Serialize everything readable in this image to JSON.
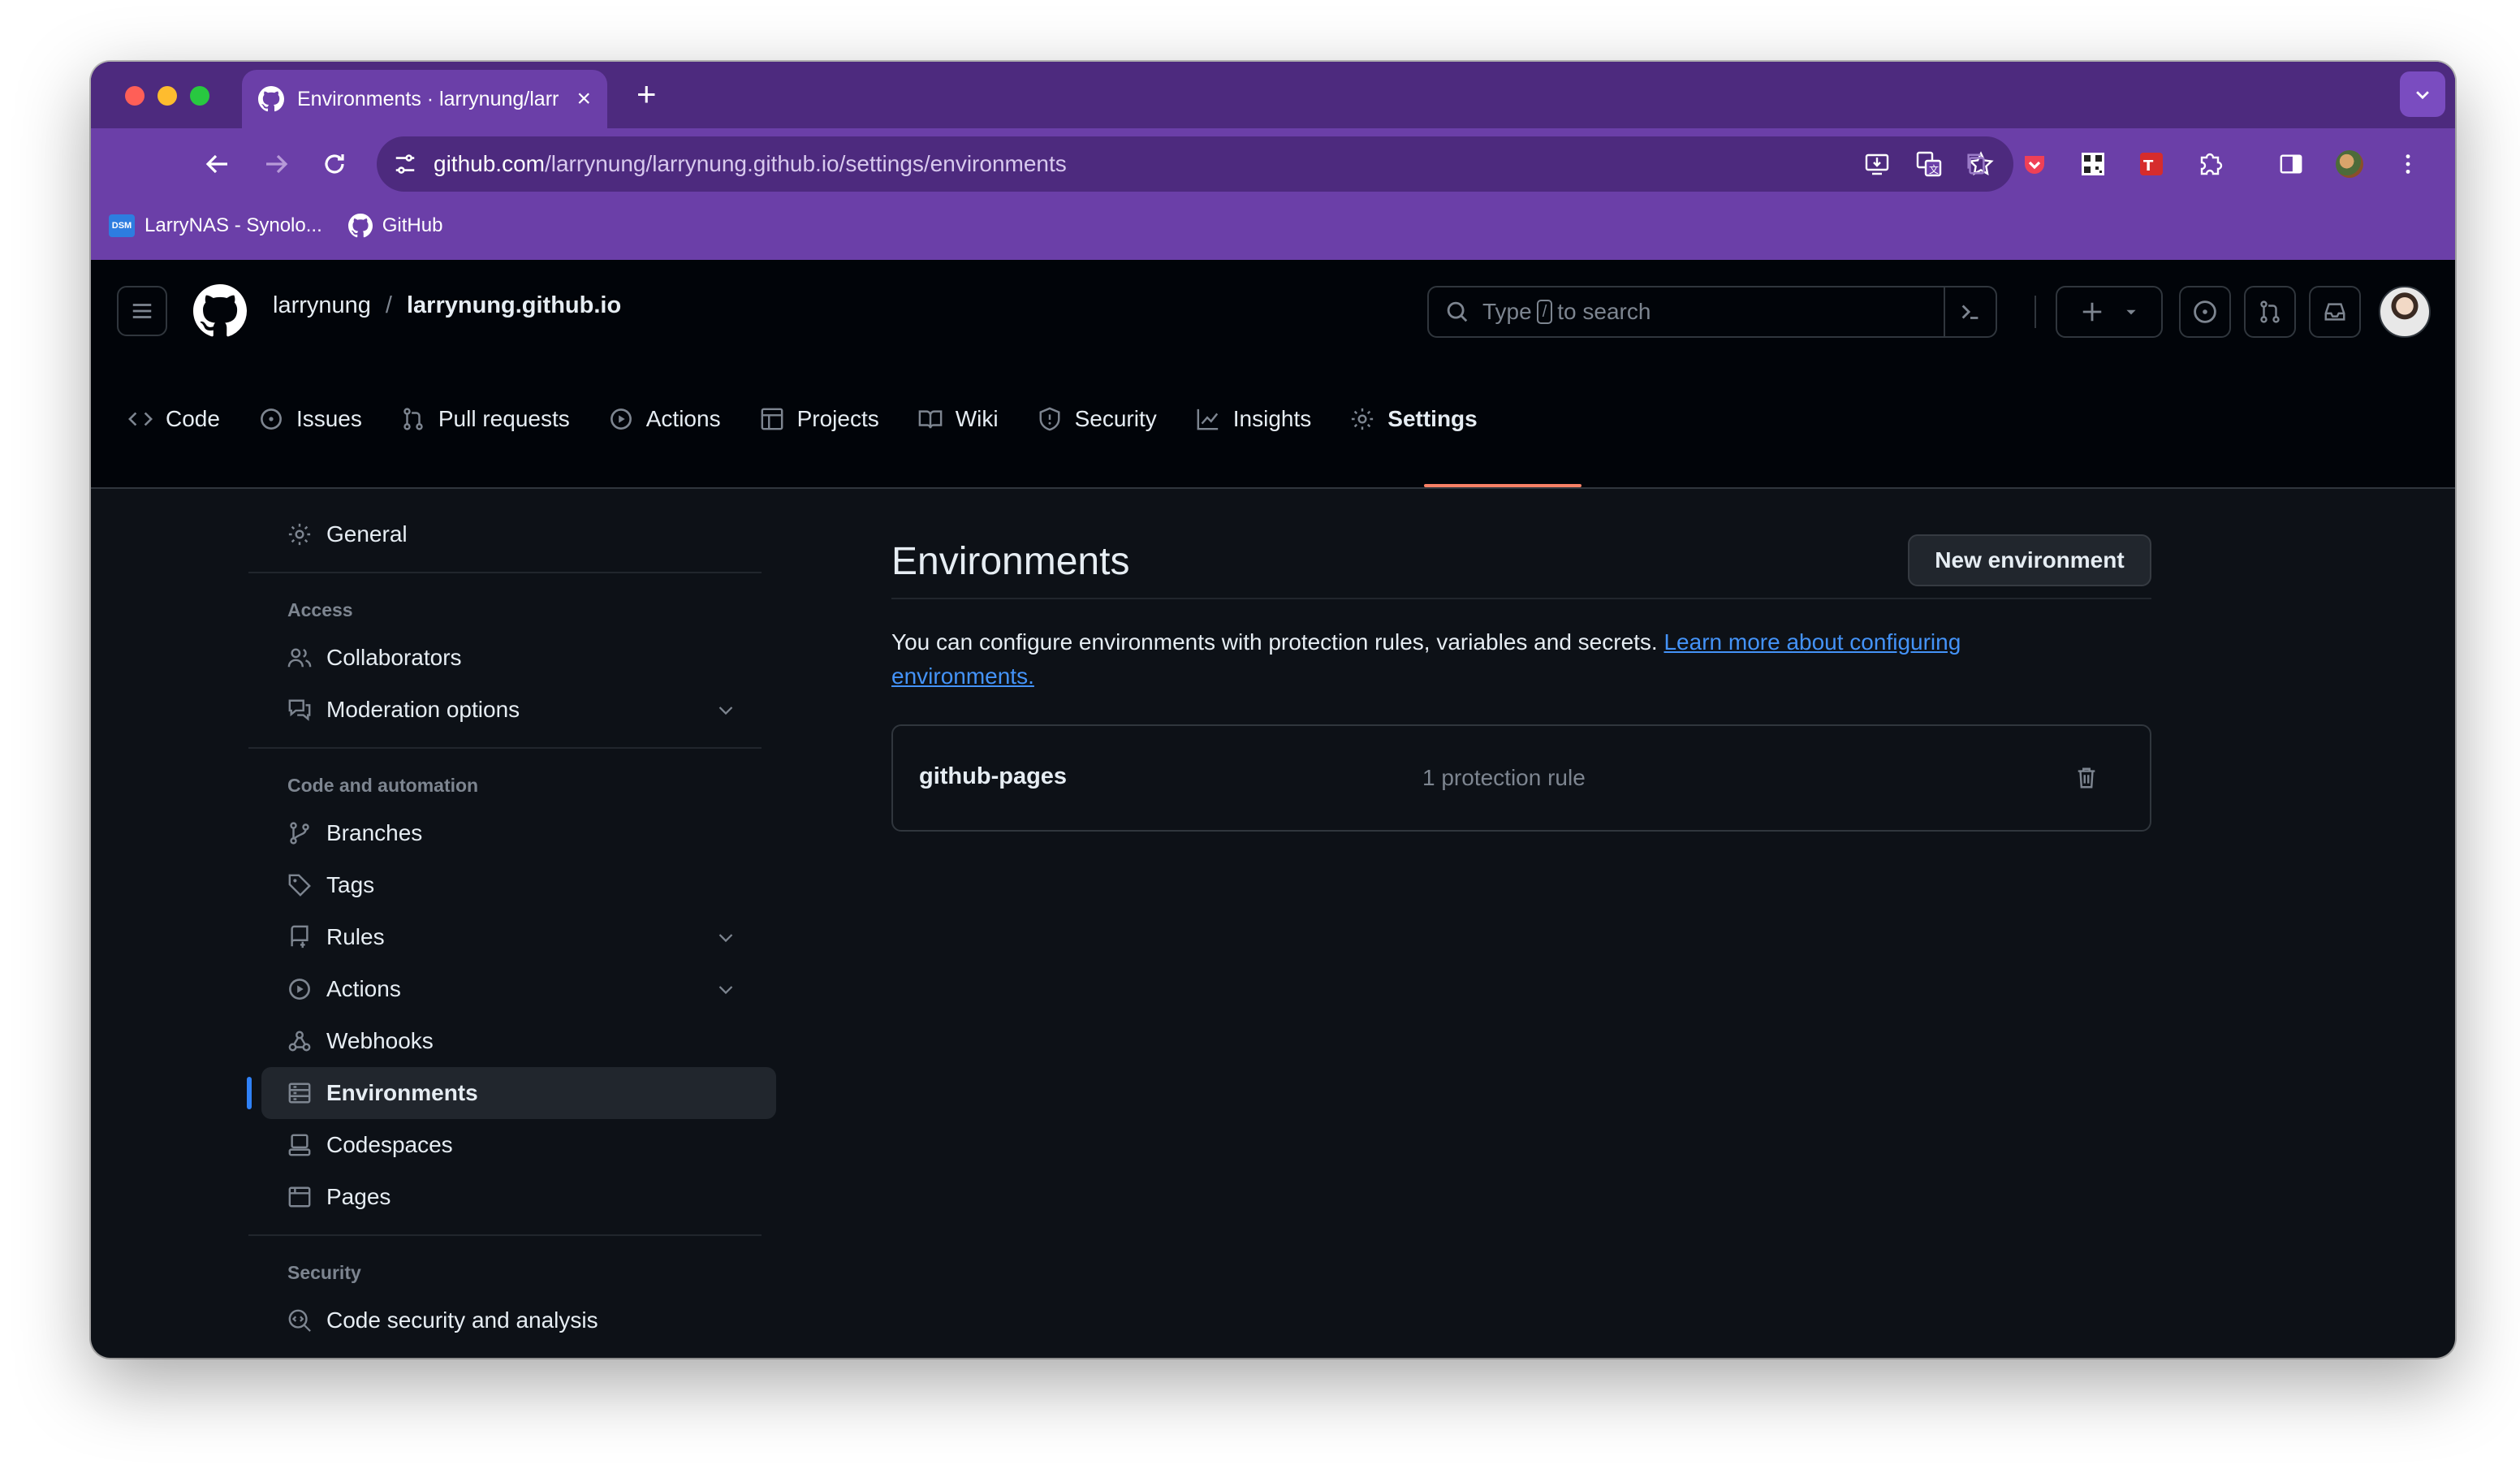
{
  "browser": {
    "tab_title": "Environments · larrynung/larr",
    "url_host": "github.com",
    "url_path": "/larrynung/larrynung.github.io/settings/environments",
    "bookmarks": [
      {
        "label": "LarryNAS - Synolo...",
        "icon": "dsm-icon",
        "badge": "DSM"
      },
      {
        "label": "GitHub",
        "icon": "github-icon"
      }
    ]
  },
  "header": {
    "owner": "larrynung",
    "separator": "/",
    "repo": "larrynung.github.io",
    "search_prefix": "Type",
    "search_key": "/",
    "search_suffix": "to search"
  },
  "repo_nav": [
    {
      "label": "Code",
      "icon": "code-icon"
    },
    {
      "label": "Issues",
      "icon": "issue-icon"
    },
    {
      "label": "Pull requests",
      "icon": "pull-request-icon"
    },
    {
      "label": "Actions",
      "icon": "play-icon"
    },
    {
      "label": "Projects",
      "icon": "table-icon"
    },
    {
      "label": "Wiki",
      "icon": "book-icon"
    },
    {
      "label": "Security",
      "icon": "shield-icon"
    },
    {
      "label": "Insights",
      "icon": "graph-icon"
    },
    {
      "label": "Settings",
      "icon": "gear-icon",
      "active": true
    }
  ],
  "sidebar": {
    "general": "General",
    "access_heading": "Access",
    "collaborators": "Collaborators",
    "moderation": "Moderation options",
    "code_heading": "Code and automation",
    "branches": "Branches",
    "tags": "Tags",
    "rules": "Rules",
    "actions": "Actions",
    "webhooks": "Webhooks",
    "environments": "Environments",
    "codespaces": "Codespaces",
    "pages": "Pages",
    "security_heading": "Security",
    "code_security": "Code security and analysis"
  },
  "main": {
    "title": "Environments",
    "new_button": "New environment",
    "description": "You can configure environments with protection rules, variables and secrets.",
    "learn_more": "Learn more about configuring environments.",
    "environments": [
      {
        "name": "github-pages",
        "rules": "1 protection rule"
      }
    ]
  },
  "colors": {
    "browser_frame": "#6b3fa8",
    "page_bg": "#0d1117",
    "header_bg": "#010409",
    "link": "#4493f8",
    "active_indicator": "#2f81f7",
    "tab_underline": "#f78166"
  }
}
